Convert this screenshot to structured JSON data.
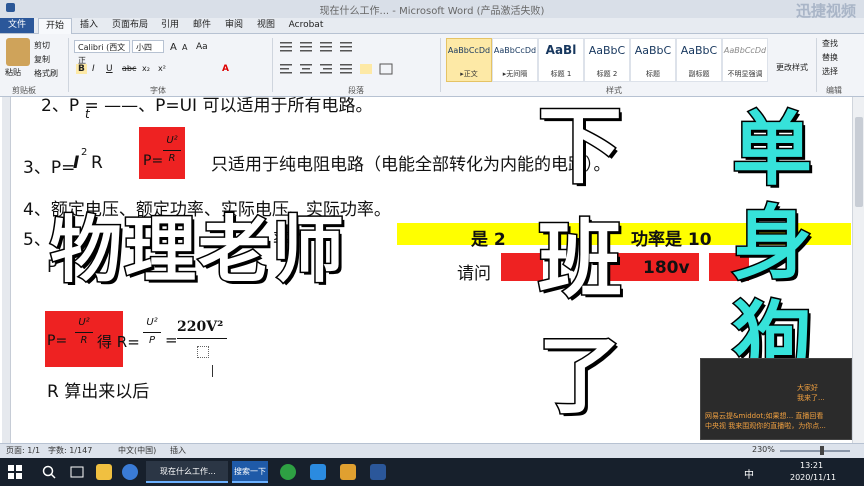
{
  "window": {
    "title": "现在什么工作... - Microsoft Word (产品激活失败)",
    "watermark": "迅捷视频",
    "controls": [
      "—",
      "❐",
      "✕"
    ]
  },
  "tabs": [
    "文件",
    "开始",
    "插入",
    "页面布局",
    "引用",
    "邮件",
    "审阅",
    "视图",
    "Acrobat"
  ],
  "ribbon": {
    "clipboard": {
      "paste": "粘贴",
      "cut": "剪切",
      "copy": "复制",
      "format_painter": "格式刷",
      "label": "剪贴板"
    },
    "font": {
      "name": "Calibri (西文正",
      "size": "小四",
      "label": "字体",
      "bold": "B",
      "italic": "I",
      "underline": "U",
      "grow": "A",
      "shrink": "A",
      "clear": "Aa",
      "strike": "abc",
      "sub": "x₂",
      "sup": "x²",
      "color": "A"
    },
    "paragraph": {
      "label": "段落"
    },
    "styles": {
      "label": "样式",
      "items": [
        {
          "sample": "AaBbCcDd",
          "name": "▸正文"
        },
        {
          "sample": "AaBbCcDd",
          "name": "▸无间隔"
        },
        {
          "sample": "AaBl",
          "name": "标题 1"
        },
        {
          "sample": "AaBbC",
          "name": "标题 2"
        },
        {
          "sample": "AaBbC",
          "name": "标题"
        },
        {
          "sample": "AaBbC",
          "name": "副标题"
        },
        {
          "sample": "AaBbCcDd",
          "name": "不明显强调"
        }
      ],
      "change": "更改样式"
    },
    "editing": {
      "find": "查找",
      "replace": "替换",
      "select": "选择",
      "label": "编辑"
    }
  },
  "document": {
    "line2": "2、P = ——、P=UI 可以适用于所有电路。",
    "line2_frac_den": "t",
    "line3_prefix": "3、P=",
    "line3_I": "I",
    "line3_exp": "2",
    "line3_R": "R",
    "line3_box_p": "P=",
    "line3_box_num": "U²",
    "line3_box_den": "R",
    "line3_text": "只适用于纯电阻电路（电能全部转化为内能的电路）。",
    "line4": "4、额定电压、额定功率、实际电压、实际功率。",
    "line5": "5、P",
    "line5_mid": "率的",
    "line5_y1": "是 2",
    "line5_y2": "功率是 10",
    "line6": "P",
    "line6_mid": "请问",
    "line6_red": "180v",
    "formula_box": "P=",
    "formula_num": "U²",
    "formula_den": "R",
    "formula_get": "得 R=",
    "formula_num2": "U²",
    "formula_den2": "P",
    "formula_eq": "=",
    "formula_val": "220V²",
    "line8": "R 算出来以后"
  },
  "overlay": {
    "big_text": "物理老师",
    "vertical_1": [
      "下",
      "班",
      "了"
    ],
    "vertical_2": [
      "单",
      "身",
      "狗"
    ]
  },
  "chat": {
    "line1": "大家好",
    "line2": "我来了...",
    "line3": "网易云提&middot;如果想... 直播回看",
    "line4": "中央视 我来围观你的直播啦，为你点..."
  },
  "status": {
    "page": "页面: 1/1",
    "words": "字数: 1/147",
    "lang": "中文(中国)",
    "insert": "插入",
    "zoom": "230%"
  },
  "taskbar": {
    "search_hint": "",
    "app1": "现在什么工作...",
    "app2": "搜索一下",
    "ime": "中",
    "time": "13:21",
    "date": "2020/11/11"
  }
}
